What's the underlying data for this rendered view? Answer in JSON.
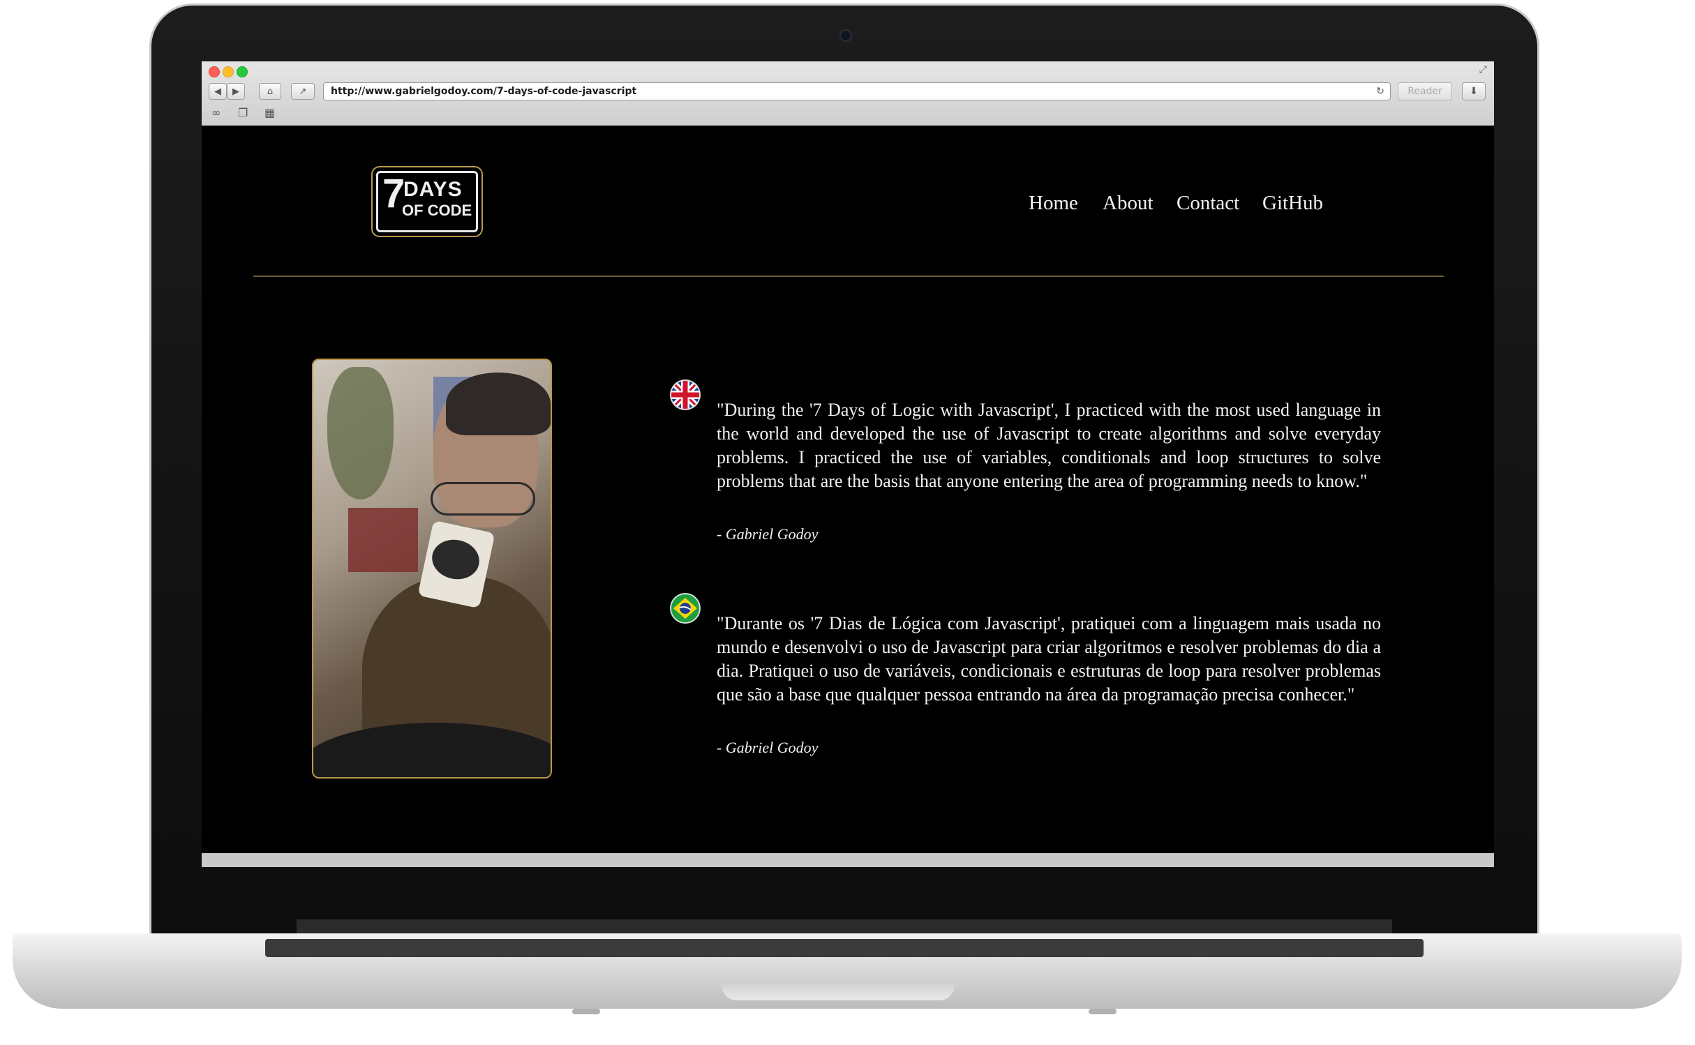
{
  "browser": {
    "url": "http://www.gabrielgodoy.com/7-days-of-code-javascript",
    "reader_label": "Reader"
  },
  "site": {
    "logo": {
      "line1_number": "7",
      "line1_text": "DAYS",
      "line2_text": "OF CODE"
    },
    "nav": [
      "Home",
      "About",
      "Contact",
      "GitHub"
    ]
  },
  "testimonials": [
    {
      "flag": "uk-flag-icon",
      "text": "\"During the '7 Days of Logic with Javascript', I practiced with the most used language in the world and developed the use of Javascript to create algorithms and solve everyday problems. I practiced the use of variables, conditionals and loop structures to solve problems that are the basis that anyone entering the area of programming needs to know.\"",
      "author": "- Gabriel Godoy"
    },
    {
      "flag": "brazil-flag-icon",
      "text": "\"Durante os '7 Dias de Lógica com Javascript', pratiquei com a linguagem mais usada no mundo e desenvolvi o uso de Javascript para criar algoritmos e resolver problemas do dia a dia. Pratiquei o uso de variáveis, condicionais e estruturas de loop para resolver problemas que são a base que qualquer pessoa entrando na área da programação precisa conhecer.\"",
      "author": "- Gabriel Godoy"
    }
  ],
  "colors": {
    "accent_gold": "#b8974f",
    "page_background": "#000000",
    "text": "#f2f2f2"
  }
}
